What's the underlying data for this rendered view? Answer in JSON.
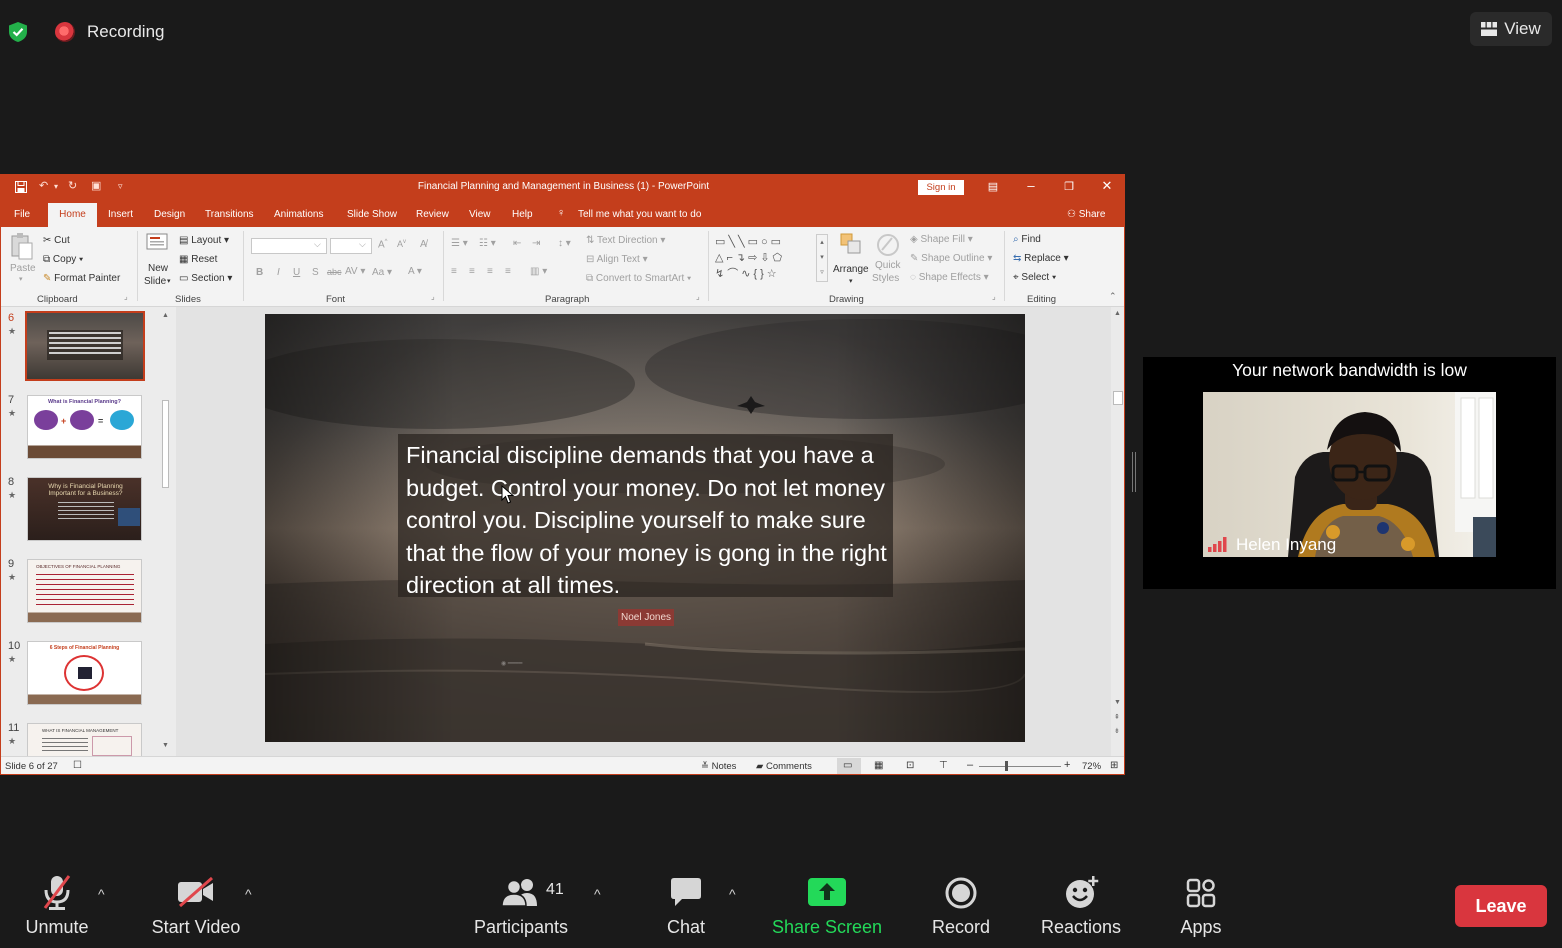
{
  "zoom": {
    "recording_label": "Recording",
    "view_label": "View",
    "bandwidth_warning": "Your network bandwidth is low",
    "participant_name": "Helen Inyang",
    "leave_label": "Leave",
    "toolbar": {
      "unmute": "Unmute",
      "start_video": "Start Video",
      "participants": "Participants",
      "participant_count": "41",
      "chat": "Chat",
      "share_screen": "Share Screen",
      "record": "Record",
      "reactions": "Reactions",
      "apps": "Apps"
    },
    "colors": {
      "share_green": "#23d959",
      "leave_red": "#d9363e",
      "recording_red": "#d9363e"
    }
  },
  "ppt": {
    "window_title": "Financial Planning and Management in Business (1)  -  PowerPoint",
    "sign_in": "Sign in",
    "accent_color": "#c43e1c",
    "tabs": [
      "File",
      "Home",
      "Insert",
      "Design",
      "Transitions",
      "Animations",
      "Slide Show",
      "Review",
      "View",
      "Help"
    ],
    "tell_me": "Tell me what you want to do",
    "share": "Share",
    "ribbon": {
      "clipboard": {
        "label": "Clipboard",
        "paste": "Paste",
        "cut": "Cut",
        "copy": "Copy",
        "format_painter": "Format Painter"
      },
      "slides": {
        "label": "Slides",
        "new_slide_1": "New",
        "new_slide_2": "Slide",
        "layout": "Layout",
        "reset": "Reset",
        "section": "Section"
      },
      "font": {
        "label": "Font",
        "bold": "B",
        "italic": "I",
        "underline": "U",
        "shadow": "S",
        "strike": "abc",
        "aa": "Aa"
      },
      "paragraph": {
        "label": "Paragraph",
        "text_direction": "Text Direction",
        "align_text": "Align Text",
        "convert_smartart": "Convert to SmartArt"
      },
      "drawing": {
        "label": "Drawing",
        "arrange": "Arrange",
        "quick_styles_1": "Quick",
        "quick_styles_2": "Styles",
        "shape_fill": "Shape Fill",
        "shape_outline": "Shape Outline",
        "shape_effects": "Shape Effects"
      },
      "editing": {
        "label": "Editing",
        "find": "Find",
        "replace": "Replace",
        "select": "Select"
      }
    },
    "slide_thumbs": [
      {
        "num": "6",
        "title": "",
        "active": true
      },
      {
        "num": "7",
        "title": "What is Financial Planning?",
        "active": false
      },
      {
        "num": "8",
        "title": "Why is Financial Planning Important for a Business?",
        "active": false
      },
      {
        "num": "9",
        "title": "OBJECTIVES OF FINANCIAL PLANNING",
        "active": false
      },
      {
        "num": "10",
        "title": "6 Steps of Financial Planning",
        "active": false
      },
      {
        "num": "11",
        "title": "WHAT IS FINANCIAL MANAGEMENT",
        "active": false
      }
    ],
    "slide": {
      "quote": "Financial discipline demands that you have a budget. Control your money. Do not let money control you. Discipline yourself to make sure that the flow of your money is gong in the right direction at all times.",
      "author": "Noel Jones"
    },
    "status": {
      "slide_counter": "Slide 6 of 27",
      "notes": "Notes",
      "comments": "Comments",
      "zoom": "72%"
    }
  }
}
